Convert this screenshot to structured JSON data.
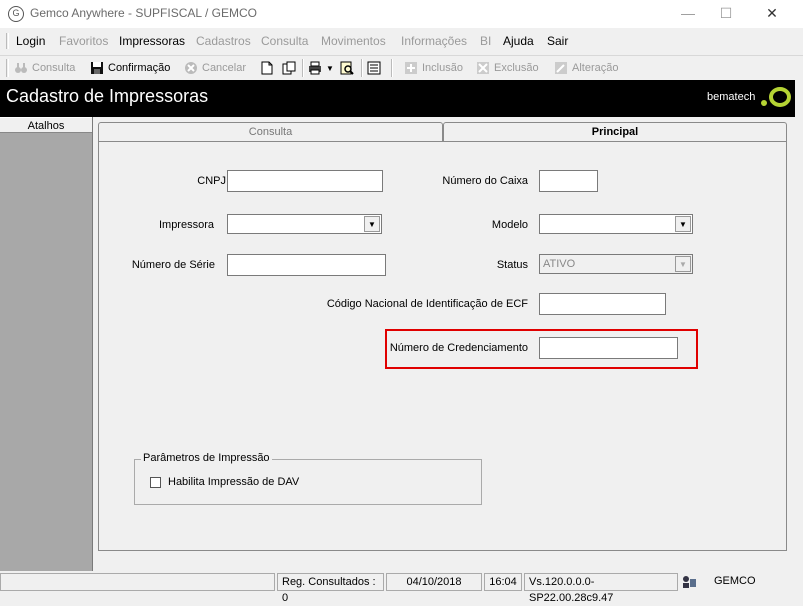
{
  "window": {
    "title": "Gemco Anywhere - SUPFISCAL / GEMCO",
    "icon": "gemco-app-icon",
    "controls": {
      "minimize": "—",
      "maximize": "☐",
      "close": "✕"
    }
  },
  "menu": {
    "items": [
      {
        "label": "Login",
        "enabled": true
      },
      {
        "label": "Favoritos",
        "enabled": false
      },
      {
        "label": "Impressoras",
        "enabled": true
      },
      {
        "label": "Cadastros",
        "enabled": false
      },
      {
        "label": "Consulta",
        "enabled": false
      },
      {
        "label": "Movimentos",
        "enabled": false
      },
      {
        "label": "Informações",
        "enabled": false
      },
      {
        "label": "BI",
        "enabled": false
      },
      {
        "label": "Ajuda",
        "enabled": true
      },
      {
        "label": "Sair",
        "enabled": true
      }
    ]
  },
  "toolbar": {
    "consulta": "Consulta",
    "confirmacao": "Confirmação",
    "cancelar": "Cancelar",
    "inclusao": "Inclusão",
    "exclusao": "Exclusão",
    "alteracao": "Alteração"
  },
  "header": {
    "title": "Cadastro de Impressoras",
    "brand": "bematech"
  },
  "sidebar": {
    "atalhos": "Atalhos"
  },
  "tabs": [
    {
      "label": "Consulta",
      "active": false
    },
    {
      "label": "Principal",
      "active": true
    }
  ],
  "form": {
    "cnpj": {
      "label": "CNPJ",
      "value": ""
    },
    "numero_caixa": {
      "label": "Número do Caixa",
      "value": ""
    },
    "impressora": {
      "label": "Impressora",
      "value": ""
    },
    "modelo": {
      "label": "Modelo",
      "value": ""
    },
    "numero_serie": {
      "label": "Número de Série",
      "value": ""
    },
    "status": {
      "label": "Status",
      "value": "ATIVO"
    },
    "codigo_nacional": {
      "label": "Código Nacional de Identificação de ECF",
      "value": ""
    },
    "numero_credenciamento": {
      "label": "Número de Credenciamento",
      "value": ""
    },
    "parametros": {
      "title": "Parâmetros de Impressão",
      "habilita_dav": {
        "label": "Habilita Impressão de DAV",
        "checked": false
      }
    }
  },
  "statusbar": {
    "reg_consultados": "Reg. Consultados : 0",
    "date": "04/10/2018",
    "time": "16:04",
    "version": "Vs.120.0.0.0-SP22.00.28c9.47",
    "company": "GEMCO"
  },
  "colors": {
    "highlight": "#e00000",
    "header_bg": "#000000",
    "brand_accent": "#b5d334"
  }
}
